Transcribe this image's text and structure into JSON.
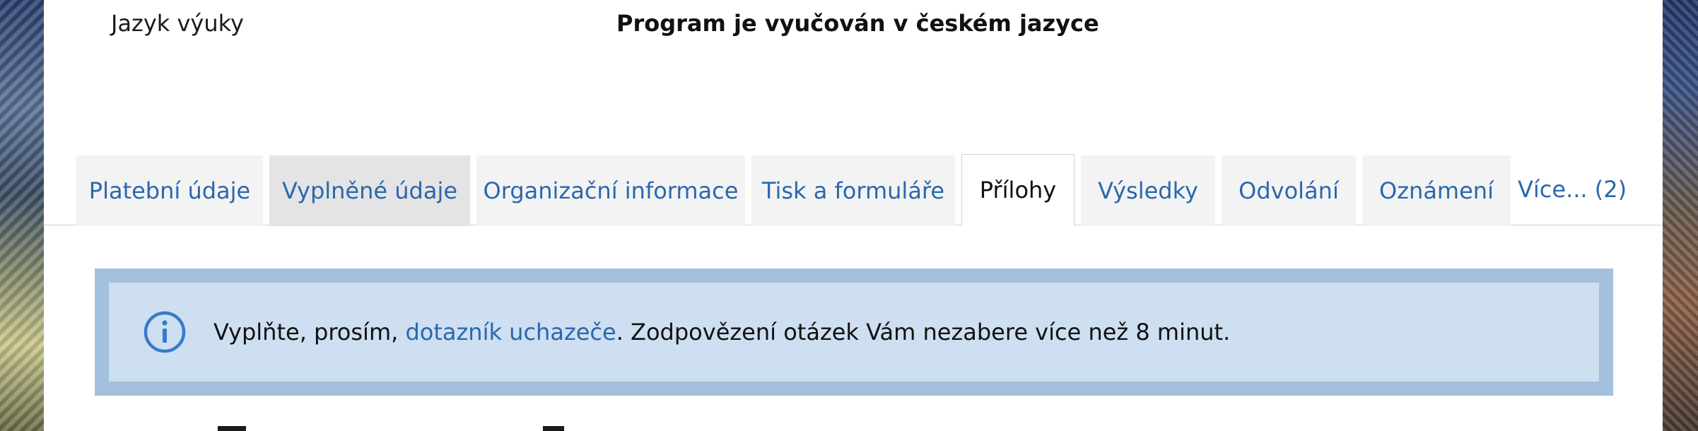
{
  "info_row": {
    "label": "Jazyk výuky",
    "value": "Program je vyučován v českém jazyce"
  },
  "tabs": [
    {
      "label": "Platební údaje",
      "state": "normal"
    },
    {
      "label": "Vyplněné údaje",
      "state": "hover"
    },
    {
      "label": "Organizační informace",
      "state": "normal"
    },
    {
      "label": "Tisk a formuláře",
      "state": "normal"
    },
    {
      "label": "Přílohy",
      "state": "active"
    },
    {
      "label": "Výsledky",
      "state": "normal"
    },
    {
      "label": "Odvolání",
      "state": "normal"
    },
    {
      "label": "Oznámení",
      "state": "normal"
    }
  ],
  "more_tabs": "Více... (2)",
  "alert": {
    "icon": "info-icon",
    "text_before": "Vyplňte, prosím, ",
    "link": "dotazník uchazeče",
    "text_after": ". Zodpovězení otázek Vám nezabere více než 8 minut."
  },
  "colors": {
    "link": "#2a67ae",
    "alert_border": "#a3c0de",
    "alert_bg": "#cddff0",
    "tab_bg": "#f3f3f3",
    "tab_hover_bg": "#e4e4e4"
  }
}
